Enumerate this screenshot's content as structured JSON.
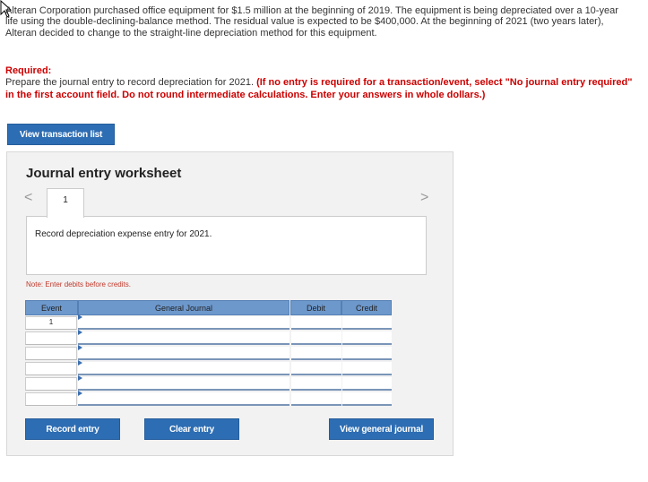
{
  "problem": {
    "text": "Alteran Corporation purchased office equipment for $1.5 million at the beginning of 2019. The equipment is being depreciated over a 10-year life using the double-declining-balance method. The residual value is expected to be $400,000. At the beginning of 2021 (two years later), Alteran decided to change to the straight-line depreciation method for this equipment."
  },
  "required": {
    "label": "Required:",
    "plain": "Prepare the journal entry to record depreciation for 2021. ",
    "emphasis": "(If no entry is required for a transaction/event, select \"No journal entry required\" in the first account field. Do not round intermediate calculations. Enter your answers in whole dollars.)"
  },
  "buttons": {
    "view_transaction_list": "View transaction list",
    "record_entry": "Record entry",
    "clear_entry": "Clear entry",
    "view_general_journal": "View general journal"
  },
  "worksheet": {
    "title": "Journal entry worksheet",
    "prev": "<",
    "next": ">",
    "tab_label": "1",
    "description": "Record depreciation expense entry for 2021.",
    "note": "Note: Enter debits before credits."
  },
  "table": {
    "headers": {
      "event": "Event",
      "general_journal": "General Journal",
      "debit": "Debit",
      "credit": "Credit"
    },
    "rows": [
      {
        "event": "1",
        "account": "",
        "debit": "",
        "credit": ""
      },
      {
        "event": "",
        "account": "",
        "debit": "",
        "credit": ""
      },
      {
        "event": "",
        "account": "",
        "debit": "",
        "credit": ""
      },
      {
        "event": "",
        "account": "",
        "debit": "",
        "credit": ""
      },
      {
        "event": "",
        "account": "",
        "debit": "",
        "credit": ""
      },
      {
        "event": "",
        "account": "",
        "debit": "",
        "credit": ""
      }
    ]
  },
  "colors": {
    "accent": "#2d6db3",
    "header": "#6d98cc",
    "required": "#cc0000"
  }
}
